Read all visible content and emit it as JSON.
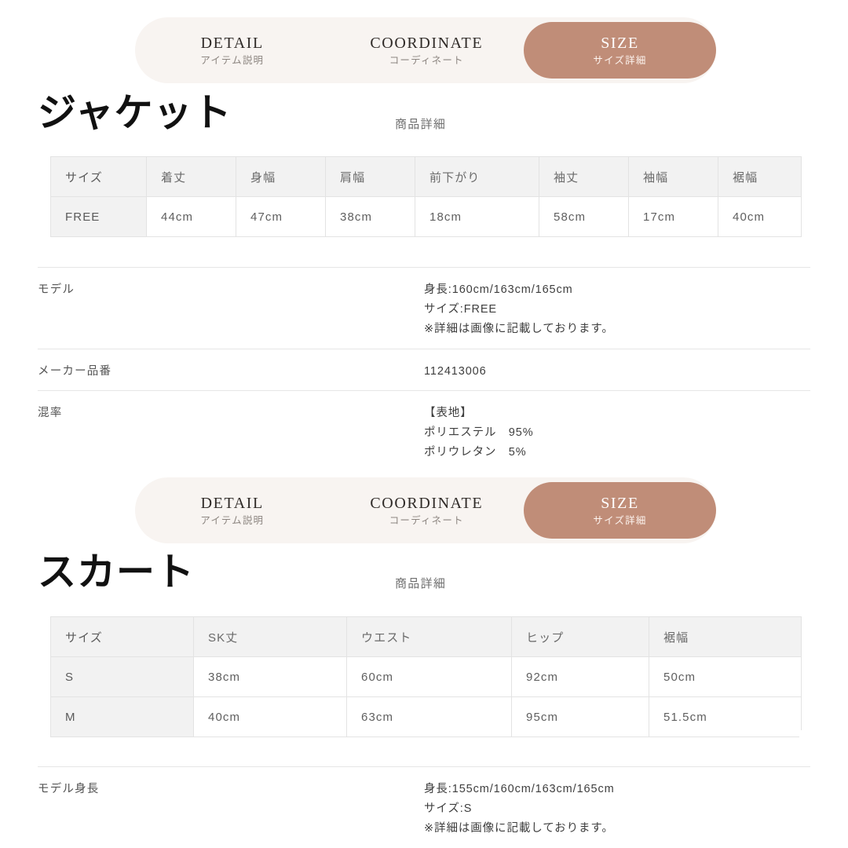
{
  "tabs": [
    {
      "en": "DETAIL",
      "jp": "アイテム説明",
      "active": false
    },
    {
      "en": "COORDINATE",
      "jp": "コーディネート",
      "active": false
    },
    {
      "en": "SIZE",
      "jp": "サイズ詳細",
      "active": true
    }
  ],
  "theme": {
    "active_tab_bg": "#c08d78",
    "tabbar_bg": "#f8f4f1",
    "table_header_bg": "#f2f2f2",
    "page_bg": "#ffffff",
    "border": "#e3e3e3"
  },
  "sections": [
    {
      "title": "ジャケット",
      "subtitle": "商品詳細",
      "table": {
        "headers": [
          "サイズ",
          "着丈",
          "身幅",
          "肩幅",
          "前下がり",
          "袖丈",
          "袖幅",
          "裾幅"
        ],
        "rows": [
          [
            "FREE",
            "44cm",
            "47cm",
            "38cm",
            "18cm",
            "58cm",
            "17cm",
            "40cm"
          ]
        ]
      },
      "specs": [
        {
          "label": "モデル",
          "values": [
            "身長:160cm/163cm/165cm",
            "サイズ:FREE",
            "※詳細は画像に記載しております。"
          ]
        },
        {
          "label": "メーカー品番",
          "values": [
            "112413006"
          ]
        },
        {
          "label": "混率",
          "values": [
            "【表地】",
            "ポリエステル　95%",
            "ポリウレタン　5%"
          ]
        }
      ]
    },
    {
      "title": "スカート",
      "subtitle": "商品詳細",
      "table": {
        "headers": [
          "サイズ",
          "SK丈",
          "ウエスト",
          "ヒップ",
          "裾幅"
        ],
        "rows": [
          [
            "S",
            "38cm",
            "60cm",
            "92cm",
            "50cm"
          ],
          [
            "M",
            "40cm",
            "63cm",
            "95cm",
            "51.5cm"
          ]
        ]
      },
      "specs": [
        {
          "label": "モデル身長",
          "values": [
            "身長:155cm/160cm/163cm/165cm",
            "サイズ:S",
            "※詳細は画像に記載しております。"
          ]
        }
      ]
    }
  ]
}
